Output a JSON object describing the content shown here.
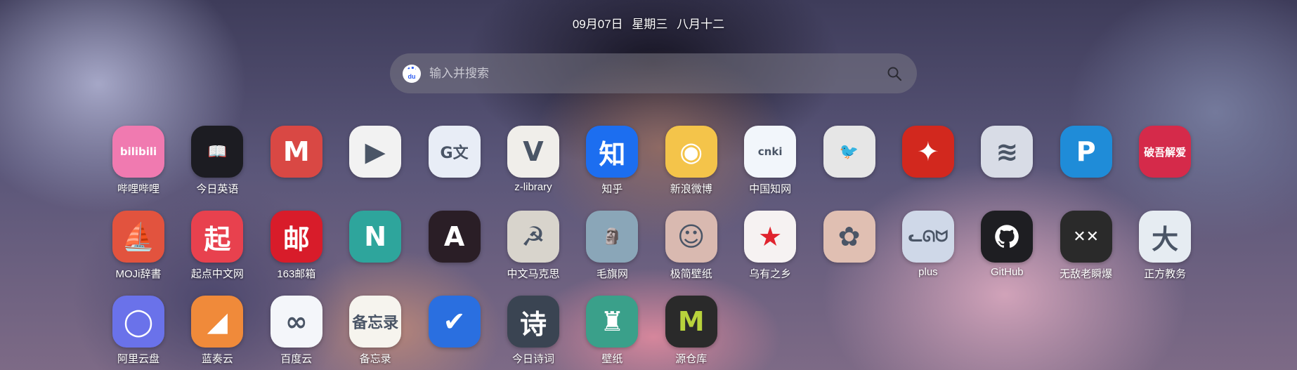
{
  "header": {
    "date": "09月07日",
    "weekday": "星期三",
    "lunar": "八月十二"
  },
  "search": {
    "engine_icon": "baidu-paw-icon",
    "engine_text": "du",
    "placeholder": "输入并搜索",
    "button_icon": "search-icon"
  },
  "apps": [
    {
      "label": "哔哩哔哩",
      "icon": "bilibili-icon",
      "glyph": "bilibili",
      "bg": "#f07ab0"
    },
    {
      "label": "今日英语",
      "icon": "book-mic-icon",
      "glyph": "📖",
      "bg": "#1c1c22"
    },
    {
      "label": "",
      "icon": "envelope-m-icon",
      "glyph": "M",
      "bg": "#d94844"
    },
    {
      "label": "",
      "icon": "tencent-video-icon",
      "glyph": "▶",
      "bg": "#f2f2f2"
    },
    {
      "label": "",
      "icon": "google-translate-icon",
      "glyph": "G文",
      "bg": "#e8edf6"
    },
    {
      "label": "z-library",
      "icon": "z-library-icon",
      "glyph": "V",
      "bg": "#f0eeea"
    },
    {
      "label": "知乎",
      "icon": "zhihu-icon",
      "glyph": "知",
      "bg": "#1c6ef0"
    },
    {
      "label": "新浪微博",
      "icon": "weibo-icon",
      "glyph": "◉",
      "bg": "#f4c44a"
    },
    {
      "label": "中国知网",
      "icon": "cnki-icon",
      "glyph": "cnki",
      "bg": "#f2f6fb"
    },
    {
      "label": "",
      "icon": "crow-icon",
      "glyph": "🐦",
      "bg": "#e6e6e6"
    },
    {
      "label": "",
      "icon": "shooting-star-icon",
      "glyph": "✦",
      "bg": "#d2281e"
    },
    {
      "label": "",
      "icon": "lines-icon",
      "glyph": "≋",
      "bg": "#d8dce6"
    },
    {
      "label": "",
      "icon": "p-letter-icon",
      "glyph": "P",
      "bg": "#1f8cd8"
    },
    {
      "label": "",
      "icon": "po-yi-jie-ai-icon",
      "glyph": "破吾解爱",
      "bg": "#d52a4a"
    },
    {
      "label": "MOJi辞書",
      "icon": "sailboat-icon",
      "glyph": "⛵",
      "bg": "#e2533e"
    },
    {
      "label": "起点中文网",
      "icon": "qidian-icon",
      "glyph": "起",
      "bg": "#e8414e"
    },
    {
      "label": "163邮箱",
      "icon": "mail163-icon",
      "glyph": "邮",
      "bg": "#d81c2a"
    },
    {
      "label": "",
      "icon": "netflix-icon",
      "glyph": "N",
      "bg": "#2ea59c"
    },
    {
      "label": "",
      "icon": "a-letter-icon",
      "glyph": "A",
      "bg": "#2a1e26"
    },
    {
      "label": "中文马克思",
      "icon": "marx-portrait-icon",
      "glyph": "☭",
      "bg": "#d8d4cc"
    },
    {
      "label": "毛旗网",
      "icon": "statue-photo-icon",
      "glyph": "🗿",
      "bg": "#8aa6b8"
    },
    {
      "label": "极简壁纸",
      "icon": "portrait-icon",
      "glyph": "☺",
      "bg": "#d9b9b0"
    },
    {
      "label": "乌有之乡",
      "icon": "red-star-icon",
      "glyph": "★",
      "bg": "#f6f2f2"
    },
    {
      "label": "",
      "icon": "anime-art-icon",
      "glyph": "✿",
      "bg": "#e0bfb2"
    },
    {
      "label": "plus",
      "icon": "catgirl-icon",
      "glyph": "ᓚᘏᗢ",
      "bg": "#cfd8e8"
    },
    {
      "label": "GitHub",
      "icon": "github-icon",
      "glyph": "",
      "bg": "#1e1e22"
    },
    {
      "label": "无敌老瞬爆",
      "icon": "xx-face-icon",
      "glyph": "✕✕",
      "bg": "#2a2a2a"
    },
    {
      "label": "正方教务",
      "icon": "university-seal-icon",
      "glyph": "大",
      "bg": "#e6ecf2"
    },
    {
      "label": "阿里云盘",
      "icon": "aliyun-drive-icon",
      "glyph": "◯",
      "bg": "#6a72ea"
    },
    {
      "label": "蓝奏云",
      "icon": "lanzou-cloud-icon",
      "glyph": "◢",
      "bg": "#f08a3a"
    },
    {
      "label": "百度云",
      "icon": "baidu-cloud-icon",
      "glyph": "∞",
      "bg": "#f4f6fa"
    },
    {
      "label": "备忘录",
      "icon": "notes-icon",
      "glyph": "备忘录",
      "bg": "#f6f4ee"
    },
    {
      "label": "",
      "icon": "checkmark-icon",
      "glyph": "✔",
      "bg": "#2a6fe0"
    },
    {
      "label": "今日诗词",
      "icon": "poetry-icon",
      "glyph": "诗",
      "bg": "#3a4452"
    },
    {
      "label": "壁纸",
      "icon": "wallpaper-icon",
      "glyph": "♜",
      "bg": "#3aa08a"
    },
    {
      "label": "源仓库",
      "icon": "m-letter-icon",
      "glyph": "M",
      "bg": "#2a2a2a"
    }
  ]
}
